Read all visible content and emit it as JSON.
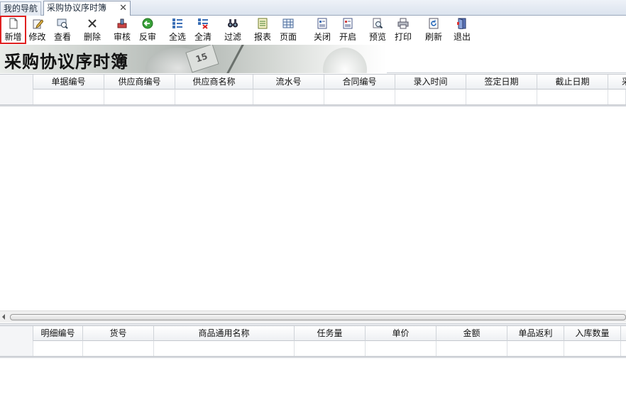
{
  "tabs": [
    {
      "label": "我的导航",
      "active": false
    },
    {
      "label": "采购协议序时簿",
      "active": true
    }
  ],
  "tab_close_glyph": "✕",
  "toolbar": [
    {
      "label": "新增",
      "icon": "new-document-icon"
    },
    {
      "label": "修改",
      "icon": "edit-icon"
    },
    {
      "label": "查看",
      "icon": "view-icon"
    },
    {
      "label": "删除",
      "icon": "delete-icon"
    },
    {
      "label": "审核",
      "icon": "audit-icon"
    },
    {
      "label": "反审",
      "icon": "unaudit-icon"
    },
    {
      "label": "全选",
      "icon": "select-all-icon"
    },
    {
      "label": "全清",
      "icon": "clear-all-icon"
    },
    {
      "label": "过滤",
      "icon": "filter-icon"
    },
    {
      "label": "报表",
      "icon": "report-icon"
    },
    {
      "label": "页面",
      "icon": "page-icon"
    },
    {
      "label": "关闭",
      "icon": "close-doc-icon"
    },
    {
      "label": "开启",
      "icon": "open-doc-icon"
    },
    {
      "label": "预览",
      "icon": "preview-icon"
    },
    {
      "label": "打印",
      "icon": "print-icon"
    },
    {
      "label": "刷新",
      "icon": "refresh-icon"
    },
    {
      "label": "退出",
      "icon": "exit-icon"
    }
  ],
  "banner": {
    "title": "采购协议序时簿",
    "decoration_number": "15"
  },
  "master_grid": {
    "columns": [
      "单据编号",
      "供应商编号",
      "供应商名称",
      "流水号",
      "合同编号",
      "录入时间",
      "签定日期",
      "截止日期",
      "采"
    ]
  },
  "detail_grid": {
    "columns": [
      "明细编号",
      "货号",
      "商品通用名称",
      "任务量",
      "单价",
      "金额",
      "单品返利",
      "入库数量"
    ]
  }
}
